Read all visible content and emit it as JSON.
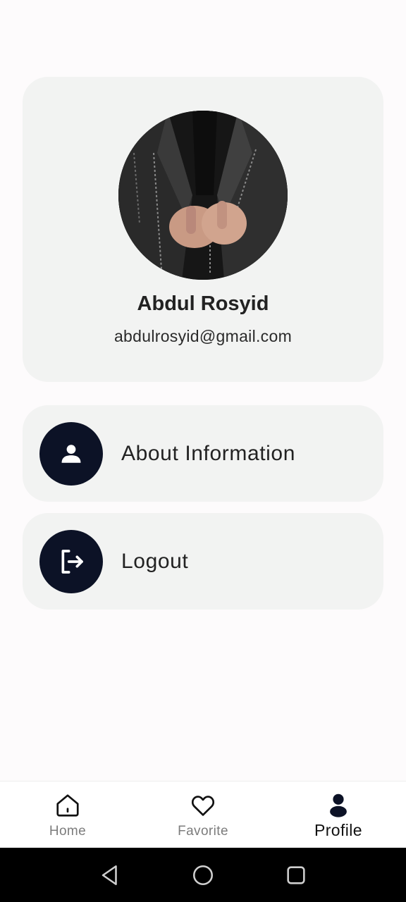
{
  "profile": {
    "name": "Abdul Rosyid",
    "email": "abdulrosyid@gmail.com",
    "avatar_icon": "profile-photo-leather-jacket"
  },
  "menu": [
    {
      "label": "About Information",
      "icon": "person-icon"
    },
    {
      "label": "Logout",
      "icon": "logout-icon"
    }
  ],
  "bottom_nav": {
    "items": [
      {
        "label": "Home",
        "icon": "home-icon",
        "active": false
      },
      {
        "label": "Favorite",
        "icon": "heart-icon",
        "active": false
      },
      {
        "label": "Profile",
        "icon": "person-icon",
        "active": true
      }
    ]
  },
  "system_nav": {
    "buttons": [
      "back-icon",
      "home-circle-icon",
      "recents-icon"
    ]
  },
  "colors": {
    "background": "#fdfbfc",
    "card": "#f2f3f2",
    "icon_circle": "#0c1226",
    "nav_inactive": "#7c7c7c",
    "nav_active": "#111111"
  }
}
